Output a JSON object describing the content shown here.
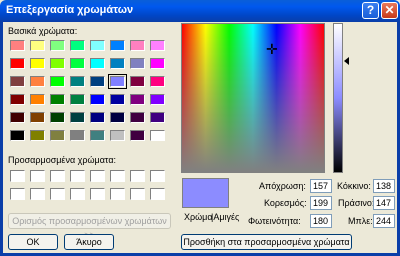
{
  "window": {
    "title": "Επεξεργασία χρωμάτων",
    "help_label": "?",
    "close_label": "✕"
  },
  "basic_colors_label": "Βασικά χρώματα:",
  "basic_colors": [
    "#ff8080",
    "#ffff80",
    "#80ff80",
    "#00ff80",
    "#80ffff",
    "#0080ff",
    "#ff80c0",
    "#ff80ff",
    "#ff0000",
    "#ffff00",
    "#80ff00",
    "#00ff40",
    "#00ffff",
    "#0080c0",
    "#8080c0",
    "#ff00ff",
    "#804040",
    "#ff8040",
    "#00ff00",
    "#008080",
    "#004080",
    "#8080ff",
    "#800040",
    "#ff0080",
    "#800000",
    "#ff8000",
    "#008000",
    "#008040",
    "#0000ff",
    "#0000a0",
    "#800080",
    "#8000ff",
    "#400000",
    "#804000",
    "#004000",
    "#004040",
    "#000080",
    "#000040",
    "#400040",
    "#400080",
    "#000000",
    "#808000",
    "#808040",
    "#808080",
    "#408080",
    "#c0c0c0",
    "#400040",
    "#ffffff"
  ],
  "selected_basic_index": 21,
  "custom_colors_label": "Προσαρμοσμένα χρώματα:",
  "define_custom_label": "Ορισμός προσαρμοσμένων χρωμάτων >>",
  "ok_label": "ΟΚ",
  "cancel_label": "Άκυρο",
  "color_solid_label": "Χρώμα",
  "solid_label": "|Αμιγές",
  "current_color": "#8c8cff",
  "fields": {
    "hue_label": "Απόχρωση:",
    "hue": "157",
    "sat_label": "Κορεσμός:",
    "sat": "199",
    "lum_label": "Φωτεινότητα:",
    "lum": "180",
    "red_label": "Κόκκινο:",
    "red": "138",
    "green_label": "Πράσινο:",
    "green": "147",
    "blue_label": "Μπλε:",
    "blue": "244"
  },
  "add_custom_label": "Προσθήκη στα προσαρμοσμένα χρώματα"
}
